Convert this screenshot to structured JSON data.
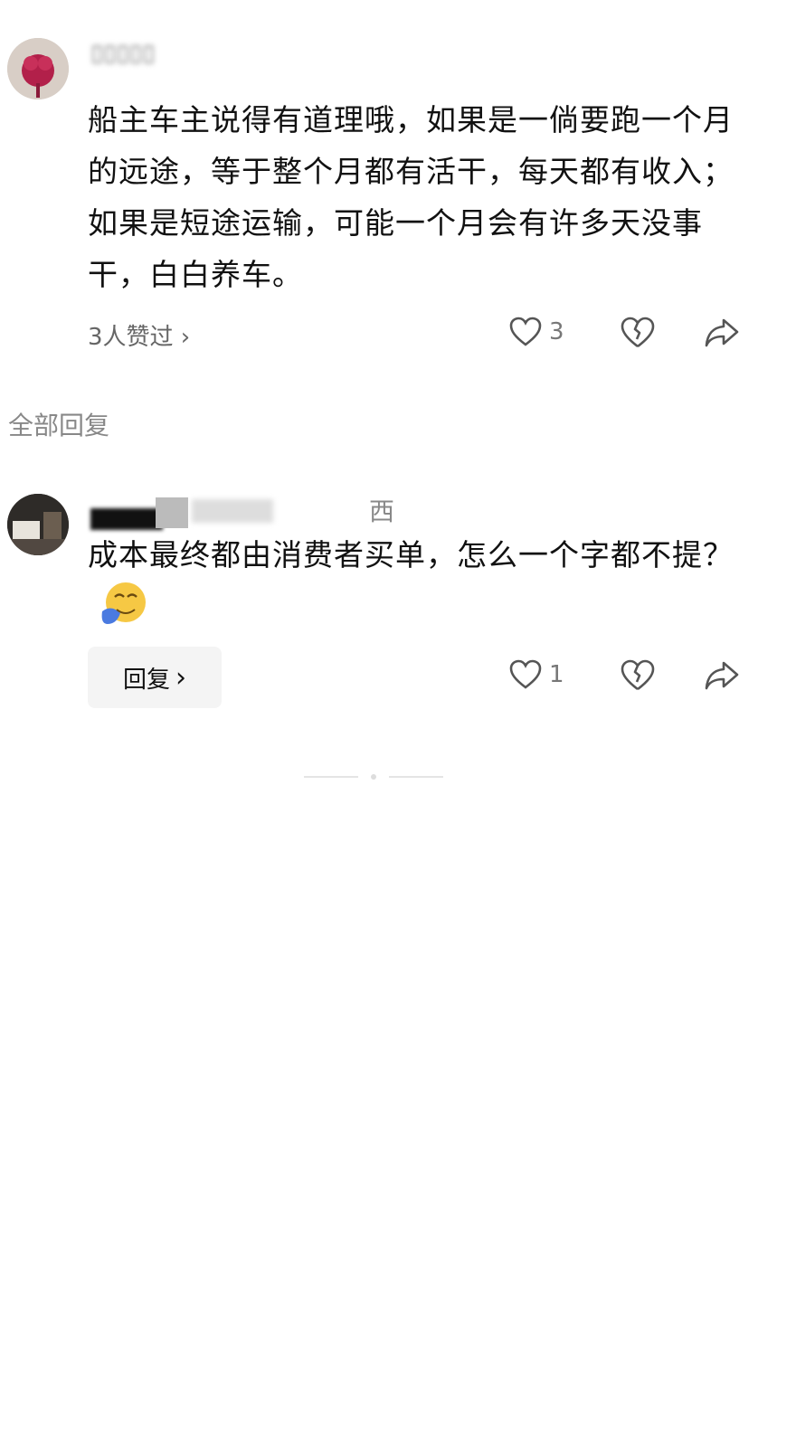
{
  "comment1": {
    "author": "▯▯▯▯▯",
    "text": "船主车主说得有道理哦，如果是一倘要跑一个月的远途，等于整个月都有活干，每天都有收入；如果是短途运输，可能一个月会有许多天没事干，白白养车。",
    "likes_summary": "3人赞过 ›",
    "like_count": "3"
  },
  "section_label": "全部回复",
  "comment2": {
    "author": "西",
    "text": "成本最终都由消费者买单，怎么一个字都不提？",
    "reply_label": "回复",
    "reply_chevron": "›",
    "like_count": "1"
  },
  "icons": {
    "like": "heart-icon",
    "dislike": "broken-heart-icon",
    "share": "share-arrow-icon",
    "emoji": "crying-face-icon"
  },
  "colors": {
    "text": "#111111",
    "muted": "#777777",
    "button_bg": "#f4f4f4"
  }
}
